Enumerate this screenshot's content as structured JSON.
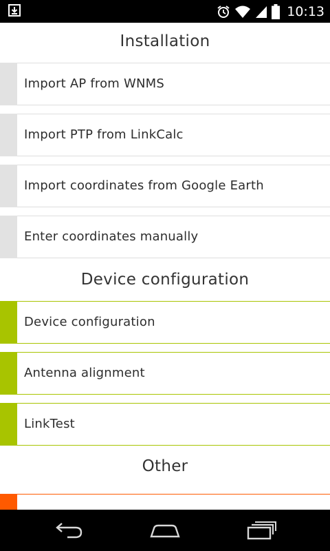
{
  "status_bar": {
    "time": "10:13",
    "icons": [
      "download-icon",
      "alarm-icon",
      "wifi-icon",
      "signal-icon",
      "battery-icon"
    ]
  },
  "sections": [
    {
      "title": "Installation"
    },
    {
      "title": "Device configuration"
    },
    {
      "title": "Other"
    }
  ],
  "installation_items": [
    {
      "label": "Import AP from WNMS"
    },
    {
      "label": "Import PTP from LinkCalc"
    },
    {
      "label": "Import coordinates from Google Earth"
    },
    {
      "label": "Enter coordinates manually"
    }
  ],
  "device_items": [
    {
      "label": "Device configuration"
    },
    {
      "label": "Antenna alignment"
    },
    {
      "label": "LinkTest"
    }
  ],
  "colors": {
    "installation_accent": "#e2e2e2",
    "device_accent": "#a8c400",
    "other_accent": "#ff5a00"
  },
  "nav_bar": {
    "buttons": [
      "back-icon",
      "home-icon",
      "recent-apps-icon"
    ]
  }
}
